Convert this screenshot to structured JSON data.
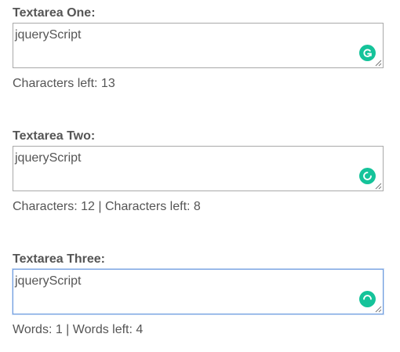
{
  "fields": [
    {
      "label": "Textarea One:",
      "value": "jqueryScript",
      "counter": "Characters left: 13"
    },
    {
      "label": "Textarea Two:",
      "value": "jqueryScript",
      "counter": "Characters: 12 | Characters left: 8"
    },
    {
      "label": "Textarea Three:",
      "value": "jqueryScript",
      "counter": "Words: 1 | Words left: 4"
    }
  ],
  "icons": {
    "grammar_badge": "grammarly-icon",
    "resize": "resize-grip-icon"
  },
  "colors": {
    "text": "#555555",
    "border": "#a9a9a9",
    "focus_border": "#6f9de0",
    "badge": "#15c39a"
  }
}
